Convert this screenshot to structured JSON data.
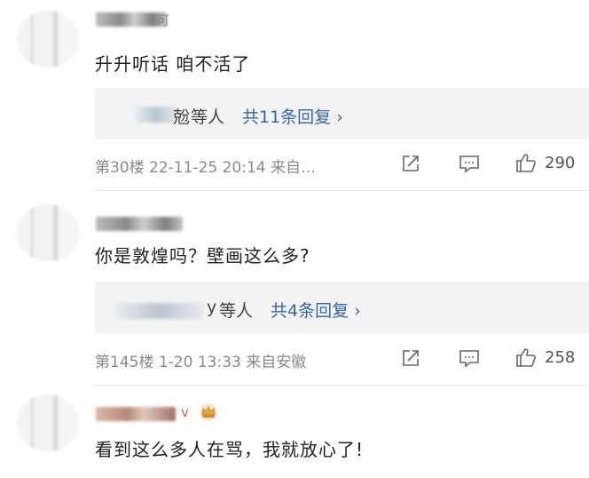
{
  "comments": [
    {
      "name_partial": "可",
      "text": "升升听话 咱不活了",
      "reply_user_partial": "兝",
      "reply_suffix": "等人",
      "reply_link": "共11条回复 ›",
      "meta": "第30楼 22-11-25 20:14 来自…",
      "likes": "290"
    },
    {
      "text": "你是敦煌吗？壁画这么多?",
      "reply_user_partial": "y",
      "reply_suffix": "等人",
      "reply_link": "共4条回复 ›",
      "meta": "第145楼 1-20 13:33 来自安徽",
      "likes": "258"
    },
    {
      "name_partial": "v",
      "text": "看到这么多人在骂，我就放心了!"
    }
  ],
  "icons": {
    "share": "share-icon",
    "comment": "comment-icon",
    "like": "thumbs-up-icon",
    "crown": "crown-badge-icon"
  }
}
